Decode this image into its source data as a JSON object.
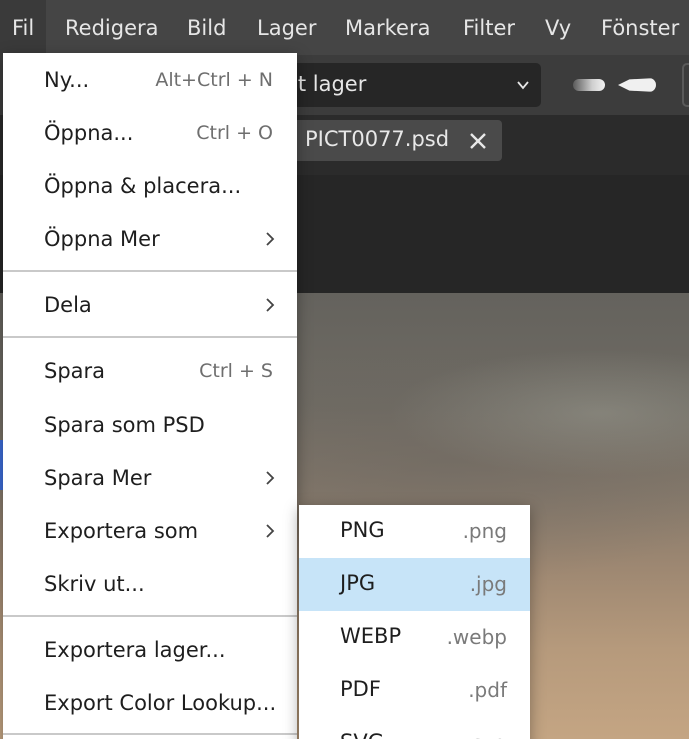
{
  "menubar": {
    "items": [
      "Fil",
      "Redigera",
      "Bild",
      "Lager",
      "Markera",
      "Filter",
      "Vy",
      "Fönster"
    ]
  },
  "options": {
    "layer_select_value": "lt lager"
  },
  "tab": {
    "title": "PICT0077.psd"
  },
  "file_menu": {
    "items": [
      {
        "label": "Ny...",
        "shortcut": "Alt+Ctrl + N"
      },
      {
        "label": "Öppna...",
        "shortcut": "Ctrl + O"
      },
      {
        "label": "Öppna & placera..."
      },
      {
        "label": "Öppna Mer",
        "submenu": true
      },
      {
        "label": "Dela",
        "submenu": true
      },
      {
        "label": "Spara",
        "shortcut": "Ctrl + S"
      },
      {
        "label": "Spara som PSD"
      },
      {
        "label": "Spara Mer",
        "submenu": true
      },
      {
        "label": "Exportera som",
        "submenu": true
      },
      {
        "label": "Skriv ut..."
      },
      {
        "label": "Exportera lager..."
      },
      {
        "label": "Export Color Lookup..."
      }
    ]
  },
  "export_submenu": {
    "items": [
      {
        "label": "PNG",
        "ext": ".png"
      },
      {
        "label": "JPG",
        "ext": ".jpg",
        "highlighted": true
      },
      {
        "label": "WEBP",
        "ext": ".webp"
      },
      {
        "label": "PDF",
        "ext": ".pdf"
      },
      {
        "label": "SVG",
        "ext": ".svg"
      }
    ]
  },
  "colors": {
    "menubar_bg": "#454545",
    "menu_bg": "#ffffff",
    "highlight": "#c7e4f8",
    "accent": "#3d6dd8"
  }
}
